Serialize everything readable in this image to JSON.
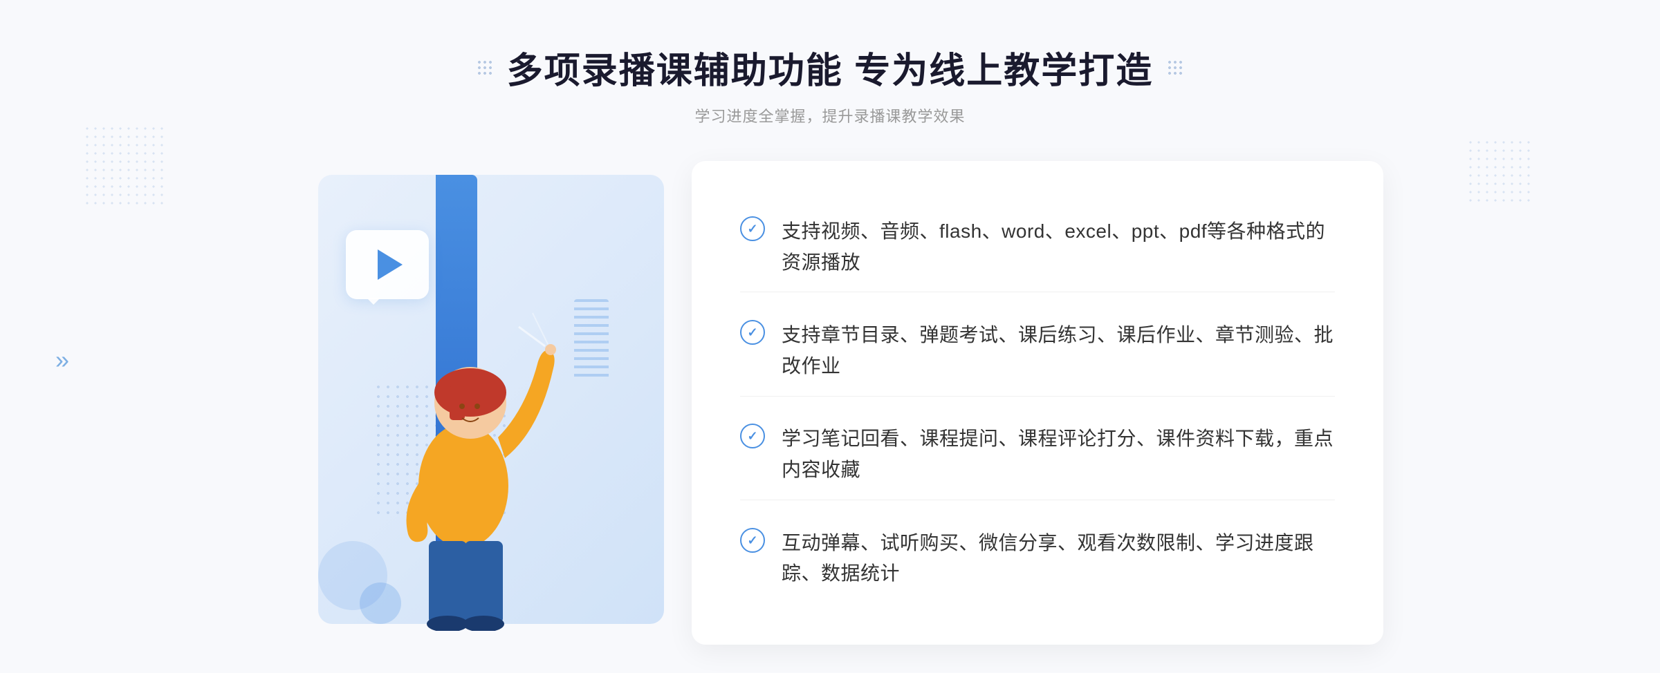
{
  "header": {
    "title": "多项录播课辅助功能 专为线上教学打造",
    "subtitle": "学习进度全掌握，提升录播课教学效果",
    "dots_left": "❋",
    "dots_right": "❋"
  },
  "features": [
    {
      "id": "feature-1",
      "text": "支持视频、音频、flash、word、excel、ppt、pdf等各种格式的资源播放"
    },
    {
      "id": "feature-2",
      "text": "支持章节目录、弹题考试、课后练习、课后作业、章节测验、批改作业"
    },
    {
      "id": "feature-3",
      "text": "学习笔记回看、课程提问、课程评论打分、课件资料下载，重点内容收藏"
    },
    {
      "id": "feature-4",
      "text": "互动弹幕、试听购买、微信分享、观看次数限制、学习进度跟踪、数据统计"
    }
  ],
  "decoration": {
    "arrow_left": "»",
    "check_symbol": "✓"
  },
  "colors": {
    "primary_blue": "#4a90e2",
    "title_color": "#1a1a2e",
    "text_color": "#333333",
    "subtitle_color": "#999999"
  }
}
